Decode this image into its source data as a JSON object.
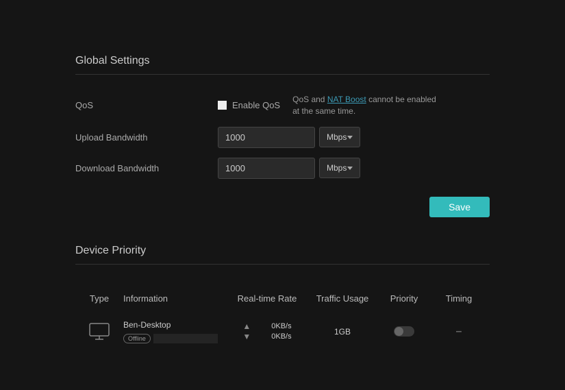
{
  "global": {
    "title": "Global Settings",
    "qos_label": "QoS",
    "enable_qos_label": "Enable QoS",
    "info_prefix": "QoS and ",
    "info_link": "NAT Boost",
    "info_suffix": " cannot be enabled at the same time.",
    "upload_label": "Upload Bandwidth",
    "upload_value": "1000",
    "upload_unit": "Mbps",
    "download_label": "Download Bandwidth",
    "download_value": "1000",
    "download_unit": "Mbps",
    "save_label": "Save"
  },
  "priority": {
    "title": "Device Priority",
    "headers": {
      "type": "Type",
      "info": "Information",
      "rate": "Real-time Rate",
      "traffic": "Traffic Usage",
      "priority": "Priority",
      "timing": "Timing"
    },
    "device": {
      "name": "Ben-Desktop",
      "status": "Offline",
      "up_rate": "0KB/s",
      "down_rate": "0KB/s",
      "traffic": "1GB",
      "timing": "–"
    }
  }
}
